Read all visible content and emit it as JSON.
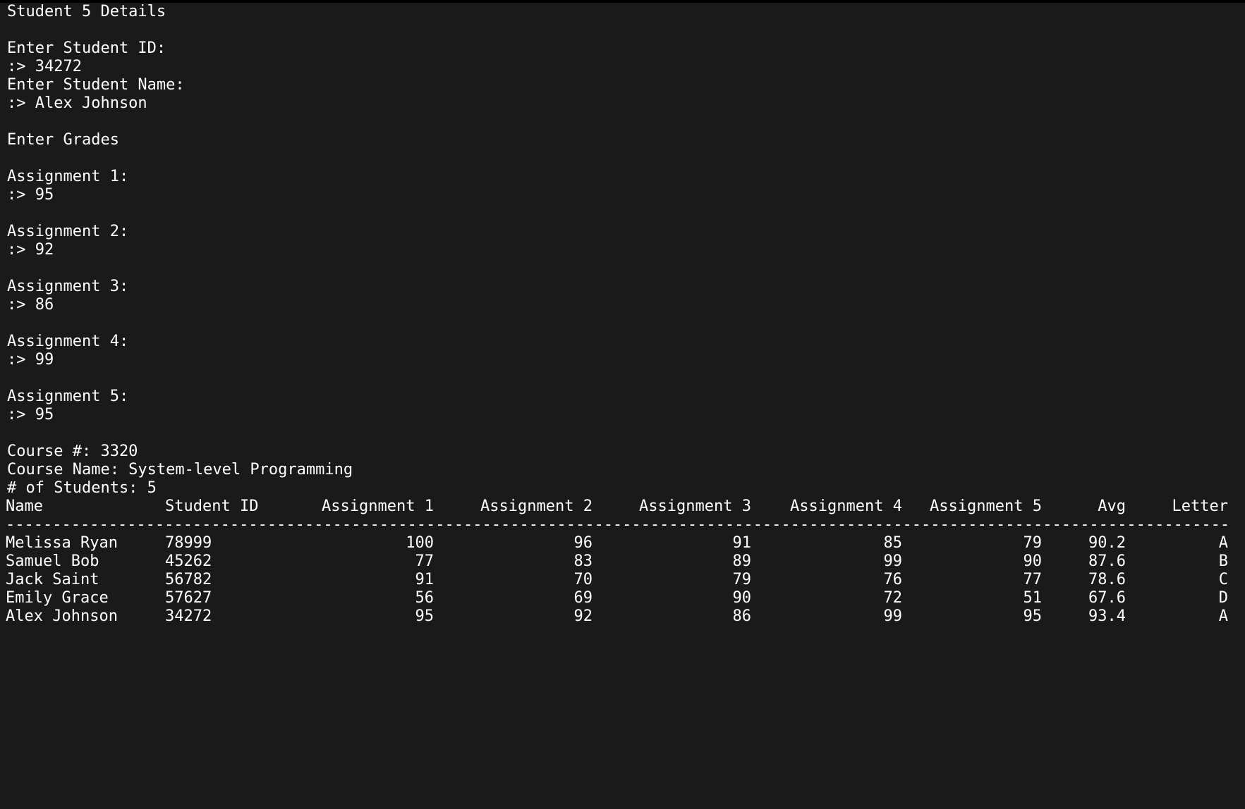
{
  "prompt": {
    "section_title": "Student 5 Details",
    "id_label": "Enter Student ID:",
    "id_input": ":> 34272",
    "name_label": "Enter Student Name:",
    "name_input": ":> Alex Johnson",
    "grades_heading": "Enter Grades",
    "assignments": [
      {
        "label": "Assignment 1:",
        "input": ":> 95"
      },
      {
        "label": "Assignment 2:",
        "input": ":> 92"
      },
      {
        "label": "Assignment 3:",
        "input": ":> 86"
      },
      {
        "label": "Assignment 4:",
        "input": ":> 99"
      },
      {
        "label": "Assignment 5:",
        "input": ":> 95"
      }
    ]
  },
  "course": {
    "number_line": "Course #: 3320",
    "name_line": "Course Name: System-level Programming",
    "count_line": "# of Students: 5"
  },
  "table": {
    "headers": {
      "name": "Name",
      "id": "Student ID",
      "a1": "Assignment 1",
      "a2": "Assignment 2",
      "a3": "Assignment 3",
      "a4": "Assignment 4",
      "a5": "Assignment 5",
      "avg": "Avg",
      "letter": "Letter"
    },
    "divider": "----------------------------------------------------------------------------------------------------------------------------------------------------",
    "rows": [
      {
        "name": "Melissa Ryan",
        "id": "78999",
        "a1": "100",
        "a2": "96",
        "a3": "91",
        "a4": "85",
        "a5": "79",
        "avg": "90.2",
        "letter": "A"
      },
      {
        "name": "Samuel Bob",
        "id": "45262",
        "a1": "77",
        "a2": "83",
        "a3": "89",
        "a4": "99",
        "a5": "90",
        "avg": "87.6",
        "letter": "B"
      },
      {
        "name": "Jack Saint",
        "id": "56782",
        "a1": "91",
        "a2": "70",
        "a3": "79",
        "a4": "76",
        "a5": "77",
        "avg": "78.6",
        "letter": "C"
      },
      {
        "name": "Emily Grace",
        "id": "57627",
        "a1": "56",
        "a2": "69",
        "a3": "90",
        "a4": "72",
        "a5": "51",
        "avg": "67.6",
        "letter": "D"
      },
      {
        "name": "Alex Johnson",
        "id": "34272",
        "a1": "95",
        "a2": "92",
        "a3": "86",
        "a4": "99",
        "a5": "95",
        "avg": "93.4",
        "letter": "A"
      }
    ]
  },
  "colors": {
    "background": "#1a1a1a",
    "text": "#ffffff"
  }
}
